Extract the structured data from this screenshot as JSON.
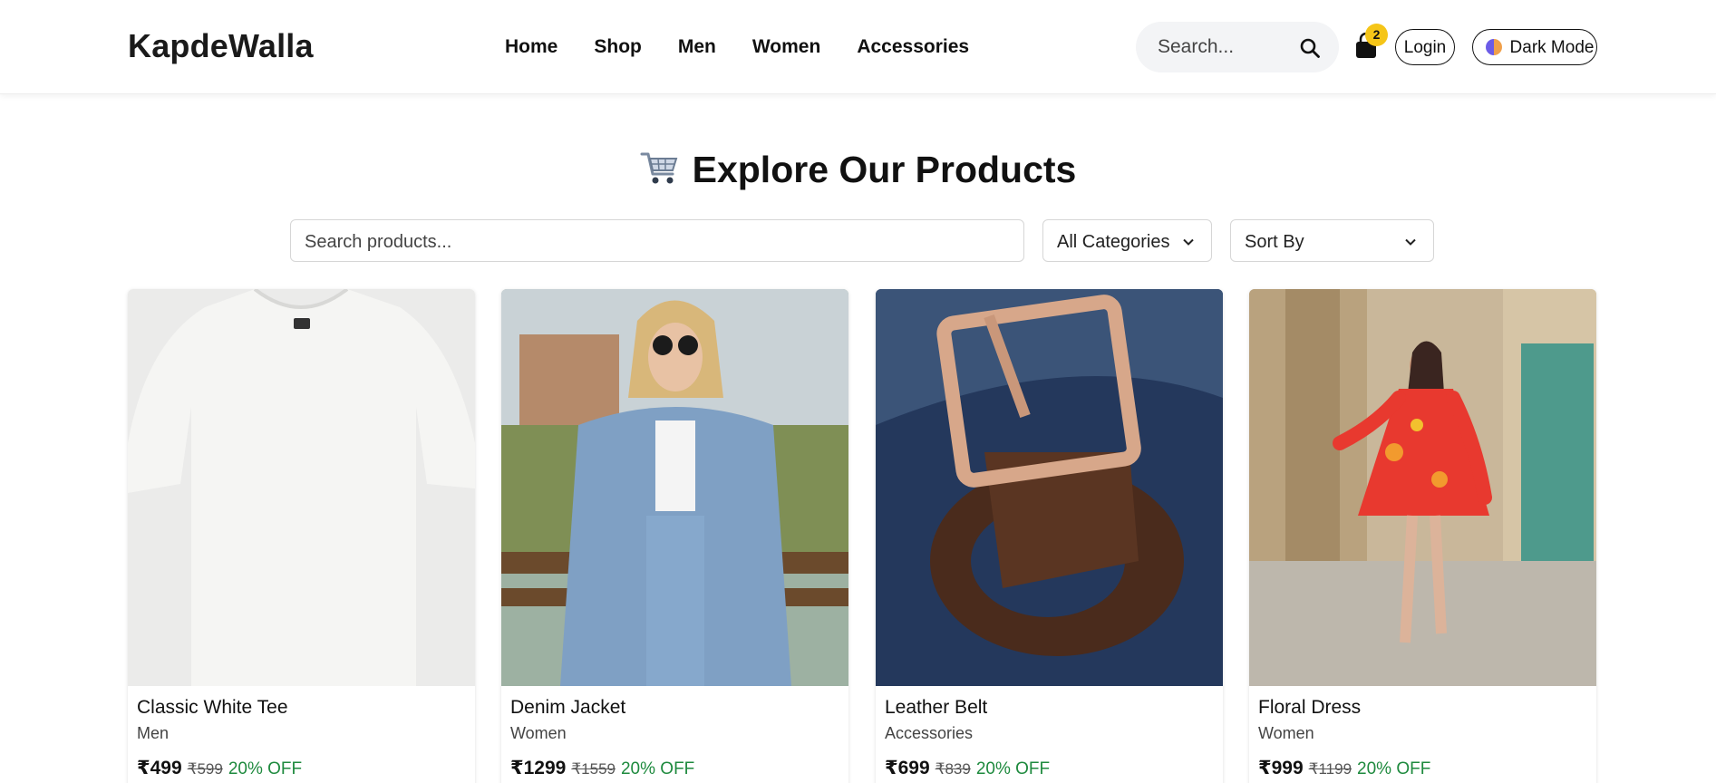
{
  "header": {
    "logo": "KapdeWalla",
    "nav": [
      "Home",
      "Shop",
      "Men",
      "Women",
      "Accessories"
    ],
    "search_placeholder": "Search...",
    "cart_count": "2",
    "login_label": "Login",
    "dark_mode_label": "Dark Mode"
  },
  "main": {
    "title": "Explore Our Products",
    "search_placeholder": "Search products...",
    "category_select": "All Categories",
    "sort_select": "Sort By"
  },
  "products": [
    {
      "name": "Classic White Tee",
      "category": "Men",
      "price": "₹499",
      "old_price": "₹599",
      "discount": "20% OFF",
      "image": "white t-shirt"
    },
    {
      "name": "Denim Jacket",
      "category": "Women",
      "price": "₹1299",
      "old_price": "₹1559",
      "discount": "20% OFF",
      "image": "woman in denim jacket"
    },
    {
      "name": "Leather Belt",
      "category": "Accessories",
      "price": "₹699",
      "old_price": "₹839",
      "discount": "20% OFF",
      "image": "brown leather belt"
    },
    {
      "name": "Floral Dress",
      "category": "Women",
      "price": "₹999",
      "old_price": "₹1199",
      "discount": "20% OFF",
      "image": "woman in floral dress"
    }
  ],
  "colors": {
    "badge": "#f5c518",
    "discount": "#1e8a3e",
    "search_bg": "#f3f4f6"
  }
}
